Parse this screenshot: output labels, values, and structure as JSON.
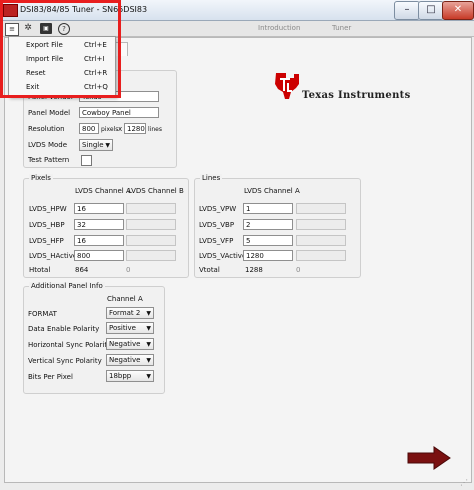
{
  "window": {
    "title": "DSI83/84/85 Tuner - SN65DSI83",
    "minimize": "–",
    "maximize": "□",
    "close": "✕"
  },
  "tabs": [
    "Introduction",
    "Tuner"
  ],
  "toolbar": {
    "help_glyph": "?"
  },
  "file_menu": {
    "items": [
      {
        "label": "Export File",
        "shortcut": "Ctrl+E"
      },
      {
        "label": "Import File",
        "shortcut": "Ctrl+I"
      },
      {
        "label": "Reset",
        "shortcut": "Ctrl+R"
      },
      {
        "label": "Exit",
        "shortcut": "Ctrl+Q"
      }
    ],
    "highlight_color": "#e81e1e"
  },
  "panel": {
    "vendor_label": "Panel Vendor",
    "vendor_value": "Texas",
    "model_label": "Panel Model",
    "model_value": "Cowboy Panel",
    "resolution_label": "Resolution",
    "res_w": "800",
    "pixels_label": "pixels",
    "x_label": "x",
    "res_h": "1280",
    "lines_label": "lines",
    "lvds_mode_label": "LVDS Mode",
    "lvds_mode_value": "Single",
    "test_pattern_label": "Test Pattern"
  },
  "pixels": {
    "title": "Pixels",
    "col_a": "LVDS Channel A",
    "col_b": "LVDS Channel B",
    "rows": [
      {
        "label": "LVDS_HPW",
        "a": "16",
        "b": ""
      },
      {
        "label": "LVDS_HBP",
        "a": "32",
        "b": ""
      },
      {
        "label": "LVDS_HFP",
        "a": "16",
        "b": ""
      },
      {
        "label": "LVDS_HActive",
        "a": "800",
        "b": ""
      }
    ],
    "total_label": "Htotal",
    "total_a": "864",
    "total_b": "0"
  },
  "lines": {
    "title": "Lines",
    "col_a": "LVDS Channel A",
    "rows": [
      {
        "label": "LVDS_VPW",
        "a": "1",
        "b": ""
      },
      {
        "label": "LVDS_VBP",
        "a": "2",
        "b": ""
      },
      {
        "label": "LVDS_VFP",
        "a": "5",
        "b": ""
      },
      {
        "label": "LVDS_VActive",
        "a": "1280",
        "b": ""
      }
    ],
    "total_label": "Vtotal",
    "total_a": "1288",
    "total_b": "0"
  },
  "additional": {
    "title": "Additional Panel Info",
    "col_a": "Channel A",
    "rows": [
      {
        "label": "FORMAT",
        "value": "Format 2"
      },
      {
        "label": "Data Enable Polarity",
        "value": "Positive"
      },
      {
        "label": "Horizontal Sync Polarity",
        "value": "Negative"
      },
      {
        "label": "Vertical Sync Polarity",
        "value": "Negative"
      },
      {
        "label": "Bits Per Pixel",
        "value": "18bpp"
      }
    ]
  },
  "logo": {
    "text": "Texas Instruments",
    "color": "#cc0000"
  },
  "next_arrow": {
    "color": "#7a1010"
  }
}
